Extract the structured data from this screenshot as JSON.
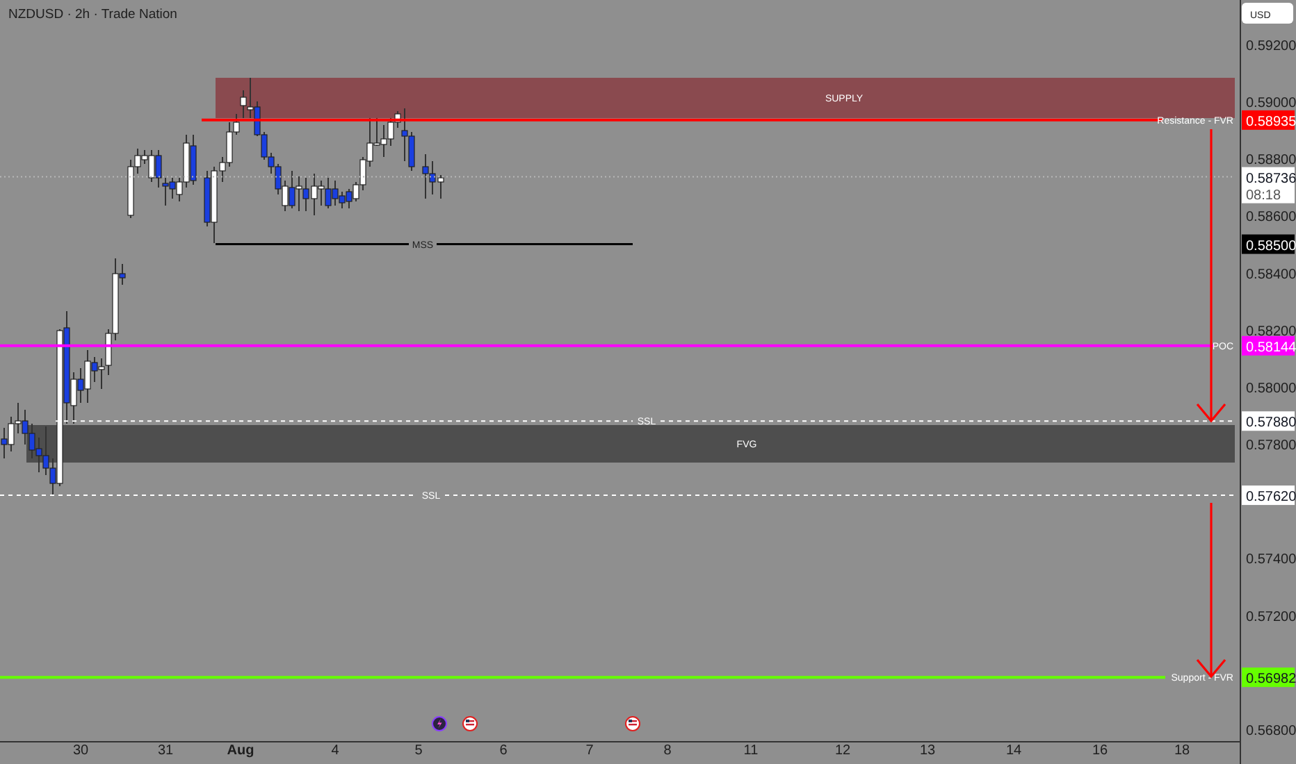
{
  "header": {
    "title": "NZDUSD · 2h · Trade Nation"
  },
  "currency": "USD",
  "price_ticks": [
    "0.59200",
    "0.59000",
    "0.58800",
    "0.58600",
    "0.58400",
    "0.58200",
    "0.58000",
    "0.57800",
    "0.57400",
    "0.57200",
    "0.56800"
  ],
  "zones": [
    {
      "kind": "supply",
      "label": "SUPPLY"
    },
    {
      "kind": "fvg",
      "label": "FVG"
    }
  ],
  "levels": [
    {
      "kind": "resistance",
      "label": "Resistance - FVR",
      "price": "0.58935",
      "color": "#ff0000"
    },
    {
      "kind": "current",
      "price": "0.58736",
      "countdown": "08:18",
      "color": "#ffffff"
    },
    {
      "kind": "mss",
      "label": "MSS",
      "price": "0.58500",
      "color": "#000000"
    },
    {
      "kind": "poc",
      "label": "POC",
      "price": "0.58144",
      "color": "#ff00ff"
    },
    {
      "kind": "ssl",
      "label": "SSL",
      "price": "0.57880",
      "color": "#ffffff"
    },
    {
      "kind": "ssl",
      "label": "SSL",
      "price": "0.57620",
      "color": "#ffffff"
    },
    {
      "kind": "support",
      "label": "Support - FVR",
      "price": "0.56982",
      "color": "#66ff00"
    }
  ],
  "events": [
    {
      "kind": "lightning"
    },
    {
      "kind": "flag"
    },
    {
      "kind": "flag"
    }
  ],
  "time_ticks": [
    {
      "label": "30",
      "kind": "day"
    },
    {
      "label": "31",
      "kind": "day"
    },
    {
      "label": "Aug",
      "kind": "month"
    },
    {
      "label": "4",
      "kind": "day"
    },
    {
      "label": "5",
      "kind": "day"
    },
    {
      "label": "6",
      "kind": "day"
    },
    {
      "label": "7",
      "kind": "day"
    },
    {
      "label": "8",
      "kind": "day"
    },
    {
      "label": "11",
      "kind": "day"
    },
    {
      "label": "12",
      "kind": "day"
    },
    {
      "label": "13",
      "kind": "day"
    },
    {
      "label": "14",
      "kind": "day"
    },
    {
      "label": "16",
      "kind": "day"
    },
    {
      "label": "18",
      "kind": "day"
    }
  ]
}
